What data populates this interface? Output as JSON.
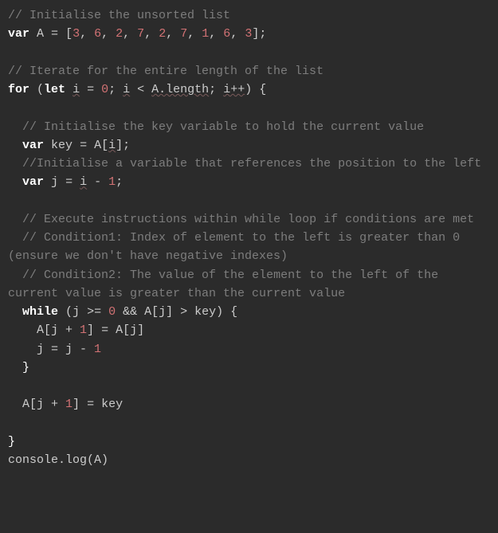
{
  "code": {
    "c1": "// Initialise the unsorted list",
    "kw_var1": "var",
    "A": "A",
    "eq": " = ",
    "lbrk": "[",
    "n0": "3",
    "n1": "6",
    "n2": "2",
    "n3": "7",
    "n4": "2",
    "n5": "7",
    "n6": "1",
    "n7": "6",
    "n8": "3",
    "comma": ", ",
    "rbrk_semi": "];",
    "c2": "// Iterate for the entire length of the list",
    "kw_for": "for",
    "for_open": " (",
    "kw_let": "let",
    "i": "i",
    "zero": "0",
    "semic": "; ",
    "lt": " < ",
    "Alen": "A.length",
    "ipp": "i++",
    "for_close": ") {",
    "c3": "// Initialise the key variable to hold the current value",
    "kw_var2": "var",
    "key": "key",
    "Aidx_open": "A[",
    "Aidx_close": "]",
    "semi": ";",
    "c4": "//Initialise a variable that references the position to the left",
    "kw_var3": "var",
    "j": "j",
    "minus1": " - ",
    "one": "1",
    "c5": "// Execute instructions within while loop if conditions are met",
    "c6": "// Condition1: Index of element to the left is greater than 0 (ensure we don't have negative indexes)",
    "c7": "// Condition2: The value of the element to the left of the current value is greater than the current value",
    "kw_while": "while",
    "while_open": " (",
    "gte": " >= ",
    "andand": " && ",
    "Aj": "A[j]",
    "gt": " > ",
    "while_close": ") {",
    "Ajp1": "A[j + ",
    "Ajp1_close": "]",
    "assign": " = ",
    "jm1a": "j = j - ",
    "rb": "}",
    "consolelog": "console.log(A)"
  }
}
